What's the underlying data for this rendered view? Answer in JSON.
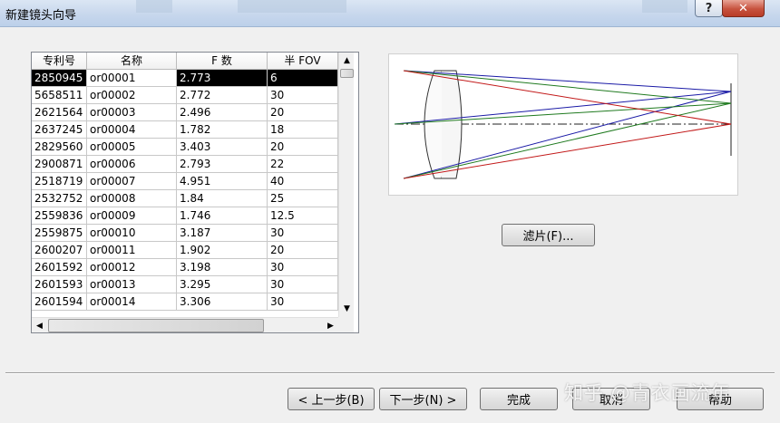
{
  "window": {
    "title": "新建镜头向导",
    "help_glyph": "?",
    "close_glyph": "✕"
  },
  "table": {
    "columns": [
      "专利号",
      "名称",
      "F 数",
      "半 FOV"
    ],
    "selected_row": 0,
    "rows": [
      [
        "2850945",
        "or00001",
        "2.773",
        "6"
      ],
      [
        "5658511",
        "or00002",
        "2.772",
        "30"
      ],
      [
        "2621564",
        "or00003",
        "2.496",
        "20"
      ],
      [
        "2637245",
        "or00004",
        "1.782",
        "18"
      ],
      [
        "2829560",
        "or00005",
        "3.403",
        "20"
      ],
      [
        "2900871",
        "or00006",
        "2.793",
        "22"
      ],
      [
        "2518719",
        "or00007",
        "4.951",
        "40"
      ],
      [
        "2532752",
        "or00008",
        "1.84",
        "25"
      ],
      [
        "2559836",
        "or00009",
        "1.746",
        "12.5"
      ],
      [
        "2559875",
        "or00010",
        "3.187",
        "30"
      ],
      [
        "2600207",
        "or00011",
        "1.902",
        "20"
      ],
      [
        "2601592",
        "or00012",
        "3.198",
        "30"
      ],
      [
        "2601593",
        "or00013",
        "3.295",
        "30"
      ],
      [
        "2601594",
        "or00014",
        "3.306",
        "30"
      ]
    ]
  },
  "buttons": {
    "filter": "滤片(F)...",
    "back": "< 上一步(B)",
    "next": "下一步(N) >",
    "finish": "完成",
    "cancel": "取消",
    "help": "帮助"
  },
  "watermark": "知乎 @青衣画流年",
  "diagram_colors": {
    "blue": "#1a1aa6",
    "green": "#1f7a1f",
    "red": "#c21818",
    "axis": "#222222"
  }
}
